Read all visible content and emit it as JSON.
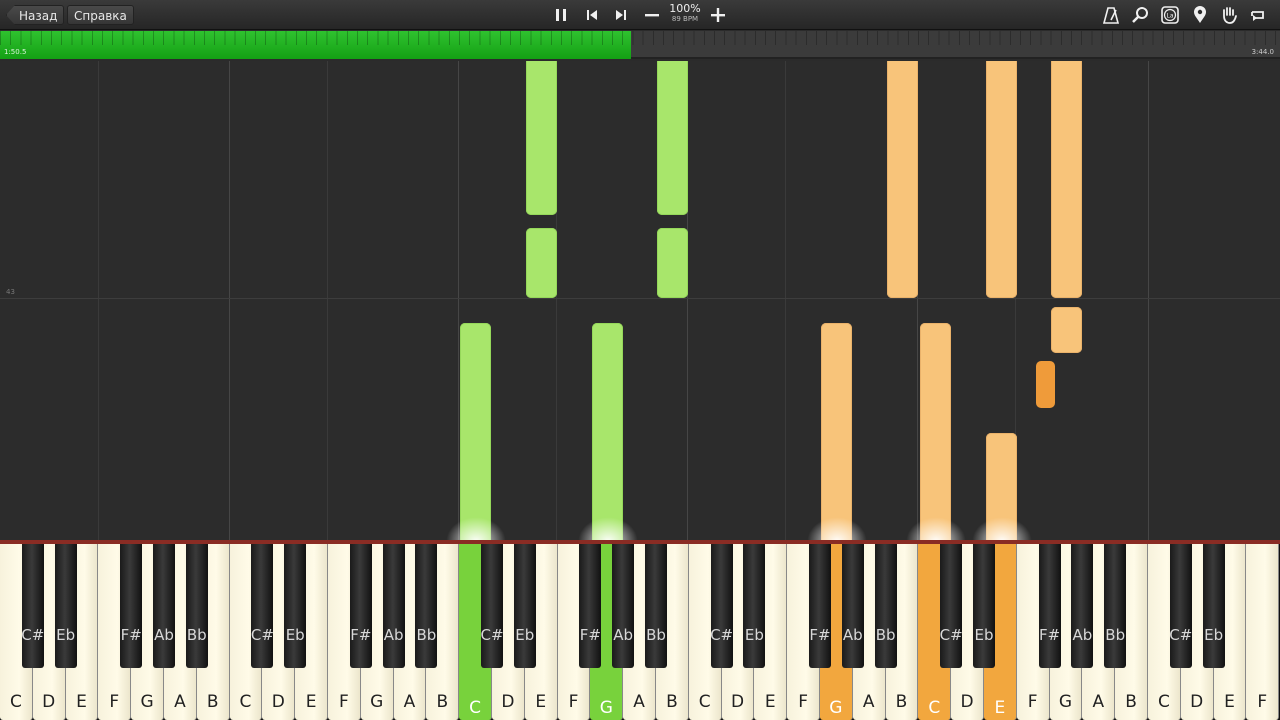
{
  "toolbar": {
    "back_label": "Назад",
    "help_label": "Справка",
    "speed_percent": "100%",
    "bpm": "89 BPM",
    "icons": [
      "pause-icon",
      "previous-icon",
      "next-icon",
      "minus-icon",
      "plus-icon",
      "metronome-icon",
      "key-search-icon",
      "note-labels-icon",
      "marker-icon",
      "hand-icon",
      "loop-icon"
    ]
  },
  "progress": {
    "current_time": "1:50.5",
    "total_time": "3:44.0",
    "fraction": 0.493,
    "fill_color": "#22b622"
  },
  "roll": {
    "measure_number": "43",
    "colors": {
      "right_hand": "#a8e66b",
      "left_hand": "#f8c47a",
      "accent": "#ef9b3a"
    }
  },
  "keyboard": {
    "white_keys": [
      "C",
      "D",
      "E",
      "F",
      "G",
      "A",
      "B",
      "C",
      "D",
      "E",
      "F",
      "G",
      "A",
      "B",
      "C",
      "D",
      "E",
      "F",
      "G",
      "A",
      "B",
      "C",
      "D",
      "E",
      "F",
      "G",
      "A",
      "B",
      "C",
      "D",
      "E",
      "F",
      "G",
      "A",
      "B",
      "C",
      "D",
      "E",
      "F"
    ],
    "black_labels": [
      "C#",
      "Eb",
      "F#",
      "Ab",
      "Bb"
    ],
    "green_keys": [
      14,
      18
    ],
    "orange_keys": [
      25,
      28,
      30
    ]
  }
}
